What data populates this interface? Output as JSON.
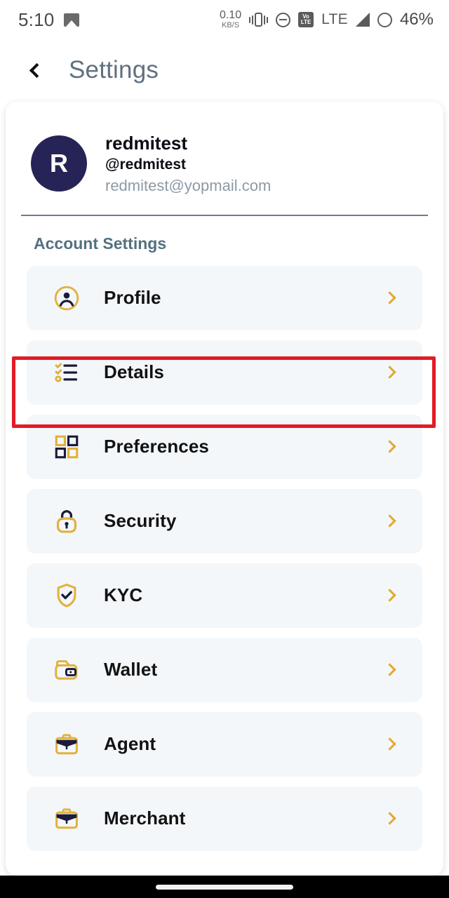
{
  "status_bar": {
    "time": "5:10",
    "image_icon": "image-icon",
    "net_speed_value": "0.10",
    "net_speed_unit": "KB/S",
    "vibrate_icon": "vibrate-icon",
    "dnd_icon": "do-not-disturb-icon",
    "volte_top": "Vo",
    "volte_bottom": "LTE",
    "network_type": "LTE",
    "signal_icon": "signal-bars-icon",
    "battery_icon": "battery-icon",
    "battery_percent": "46%"
  },
  "app_bar": {
    "back_icon": "back-chevron-icon",
    "title": "Settings"
  },
  "profile": {
    "avatar_initial": "R",
    "name": "redmitest",
    "handle": "@redmitest",
    "email": "redmitest@yopmail.com"
  },
  "section": {
    "title": "Account Settings"
  },
  "rows": [
    {
      "label": "Profile",
      "icon": "user-circle-icon",
      "chevron": "chevron-right-icon",
      "highlighted": false
    },
    {
      "label": "Details",
      "icon": "checklist-icon",
      "chevron": "chevron-right-icon",
      "highlighted": true
    },
    {
      "label": "Preferences",
      "icon": "grid-squares-icon",
      "chevron": "chevron-right-icon",
      "highlighted": false
    },
    {
      "label": "Security",
      "icon": "lock-icon",
      "chevron": "chevron-right-icon",
      "highlighted": false
    },
    {
      "label": "KYC",
      "icon": "shield-check-icon",
      "chevron": "chevron-right-icon",
      "highlighted": false
    },
    {
      "label": "Wallet",
      "icon": "wallet-icon",
      "chevron": "chevron-right-icon",
      "highlighted": false
    },
    {
      "label": "Agent",
      "icon": "briefcase-icon",
      "chevron": "chevron-right-icon",
      "highlighted": false
    },
    {
      "label": "Merchant",
      "icon": "briefcase-icon",
      "chevron": "chevron-right-icon",
      "highlighted": false
    }
  ],
  "colors": {
    "accent_gold": "#e2b13c",
    "icon_navy": "#1b1b3a",
    "avatar_navy": "#262456",
    "row_bg": "#f4f7fa",
    "title_slate": "#607180",
    "section_slate": "#55707f",
    "highlight_red": "#e21b24",
    "email_gray": "#8d9aa5"
  },
  "nav_bar": {
    "home_indicator": "home-indicator"
  }
}
